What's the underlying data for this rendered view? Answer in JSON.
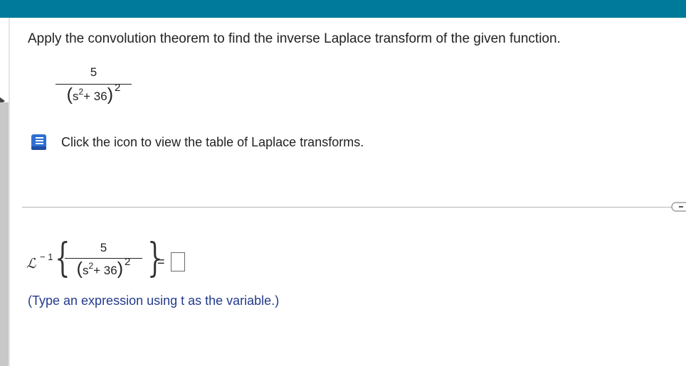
{
  "colors": {
    "topbar": "#007a9a",
    "hint_text": "#233a8e",
    "icon_blue": "#2f6fd1"
  },
  "question": {
    "instruction": "Apply the convolution theorem to find the inverse Laplace transform of the given function.",
    "numerator": "5",
    "denominator_base": "s",
    "denominator_base_exp": "2",
    "denominator_const": " + 36",
    "denominator_outer_exp": "2"
  },
  "help": {
    "icon": "book-icon",
    "link_text": "Click the icon to view the table of Laplace transforms."
  },
  "answer": {
    "operator": "ℒ",
    "operator_exp": "− 1",
    "numerator": "5",
    "denominator_base": "s",
    "denominator_base_exp": "2",
    "denominator_const": " + 36",
    "denominator_outer_exp": "2",
    "equals": "=",
    "value": "",
    "hint": "(Type an expression using t as the variable.)"
  }
}
